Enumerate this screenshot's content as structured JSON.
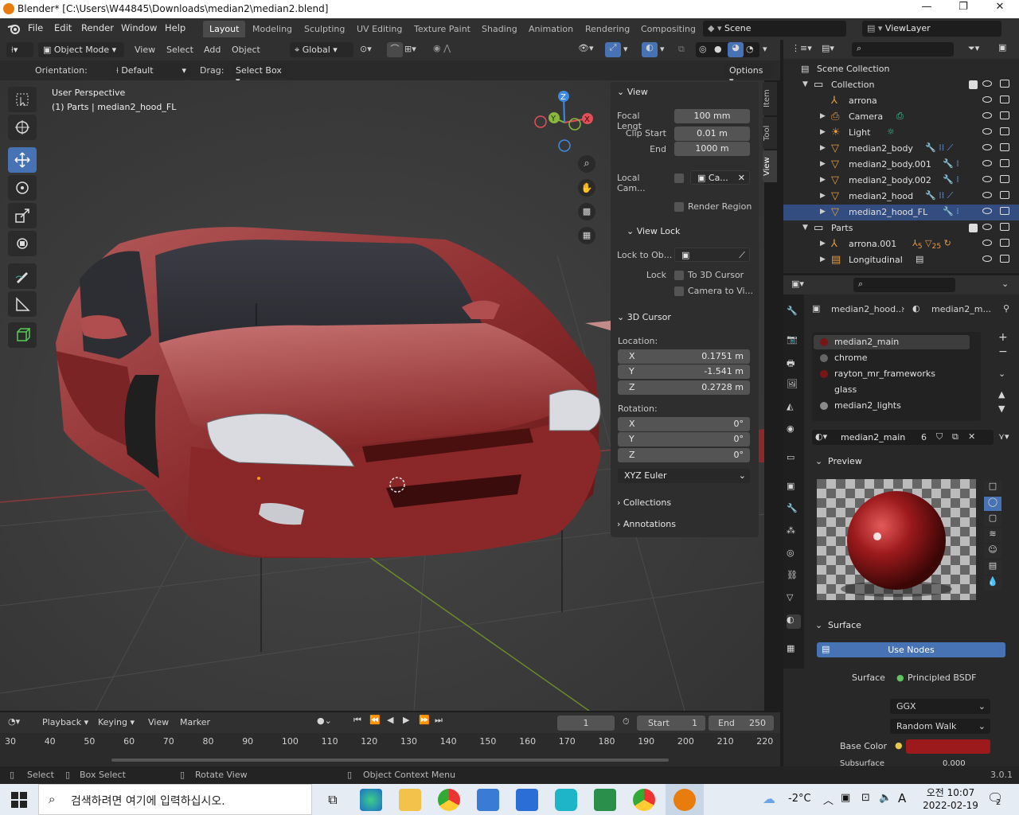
{
  "window": {
    "title": "Blender* [C:\\Users\\W44845\\Downloads\\median2\\median2.blend]",
    "min": "—",
    "max": "❐",
    "close": "✕"
  },
  "menu": [
    "File",
    "Edit",
    "Render",
    "Window",
    "Help"
  ],
  "workspaces": [
    "Layout",
    "Modeling",
    "Sculpting",
    "UV Editing",
    "Texture Paint",
    "Shading",
    "Animation",
    "Rendering",
    "Compositing"
  ],
  "scene": "Scene",
  "view_layer": "ViewLayer",
  "header": {
    "mode": "Object Mode",
    "menus": [
      "View",
      "Select",
      "Add",
      "Object"
    ],
    "transform": "Global"
  },
  "header2": {
    "orientation_label": "Orientation:",
    "orientation": "Default",
    "drag_label": "Drag:",
    "drag": "Select Box",
    "options": "Options"
  },
  "viewport": {
    "line1": "User Perspective",
    "line2": "(1) Parts | median2_hood_FL"
  },
  "gizmo": {
    "x": "X",
    "y": "Y",
    "z": "Z"
  },
  "npanel": {
    "tabs": [
      "Item",
      "Tool",
      "View"
    ],
    "view_title": "View",
    "focal_label": "Focal Lengt",
    "focal": "100 mm",
    "clip_start_label": "Clip Start",
    "clip_start": "0.01 m",
    "end_label": "End",
    "clip_end": "1000 m",
    "local_cam_label": "Local Cam...",
    "local_cam_value": "Ca...",
    "render_region": "Render Region",
    "view_lock_title": "View Lock",
    "lock_to_obj_label": "Lock to Ob...",
    "lock_label": "Lock",
    "to_3d_cursor": "To 3D Cursor",
    "camera_to_view": "Camera to Vi...",
    "cursor_title": "3D Cursor",
    "location_label": "Location:",
    "loc": [
      {
        "axis": "X",
        "value": "0.1751 m"
      },
      {
        "axis": "Y",
        "value": "-1.541 m"
      },
      {
        "axis": "Z",
        "value": "0.2728 m"
      }
    ],
    "rotation_label": "Rotation:",
    "rot": [
      {
        "axis": "X",
        "value": "0°"
      },
      {
        "axis": "Y",
        "value": "0°"
      },
      {
        "axis": "Z",
        "value": "0°"
      }
    ],
    "rot_mode": "XYZ Euler",
    "collections": "Collections",
    "annotations": "Annotations"
  },
  "outliner": {
    "root": "Scene Collection",
    "rows": [
      {
        "name": "Collection",
        "indent": 1,
        "icon": "collection-icon",
        "color": "#e6e6e6"
      },
      {
        "name": "arrona",
        "indent": 2,
        "icon": "armature-icon",
        "color": "#e69a43"
      },
      {
        "name": "Camera",
        "indent": 2,
        "icon": "camera-object-icon",
        "color": "#e69a43"
      },
      {
        "name": "Light",
        "indent": 2,
        "icon": "light-icon",
        "color": "#e69a43"
      },
      {
        "name": "median2_body",
        "indent": 2,
        "icon": "mesh-icon",
        "color": "#e69a43"
      },
      {
        "name": "median2_body.001",
        "indent": 2,
        "icon": "mesh-icon",
        "color": "#e69a43"
      },
      {
        "name": "median2_body.002",
        "indent": 2,
        "icon": "mesh-icon",
        "color": "#e69a43"
      },
      {
        "name": "median2_hood",
        "indent": 2,
        "icon": "mesh-icon",
        "color": "#e69a43"
      },
      {
        "name": "median2_hood_FL",
        "indent": 2,
        "icon": "mesh-icon",
        "color": "#e69a43"
      },
      {
        "name": "Parts",
        "indent": 1,
        "icon": "collection-icon",
        "color": "#e6e6e6"
      },
      {
        "name": "arrona.001",
        "indent": 2,
        "icon": "armature-icon",
        "color": "#e69a43"
      },
      {
        "name": "Longitudinal",
        "indent": 2,
        "icon": "empty-icon",
        "color": "#e69a43"
      }
    ],
    "badge1": "5",
    "badge2": "25"
  },
  "props": {
    "breadcrumb1": "median2_hood...",
    "breadcrumb2": "median2_m...",
    "materials": [
      "median2_main",
      "chrome",
      "rayton_mr_frameworks",
      "glass",
      "median2_lights"
    ],
    "material_name": "median2_main",
    "users": "6",
    "preview": "Preview",
    "surface_section": "Surface",
    "use_nodes": "Use Nodes",
    "surface_label": "Surface",
    "surface_value": "Principled BSDF",
    "distribution": "GGX",
    "subsurface_method": "Random Walk",
    "base_color_label": "Base Color",
    "base_color": "#9c1a1c",
    "subsurface_label": "Subsurface",
    "subsurface_value": "0.000"
  },
  "timeline": {
    "menus": [
      "Playback",
      "Keying",
      "View",
      "Marker"
    ],
    "current": "1",
    "start_label": "Start",
    "start": "1",
    "end_label": "End",
    "end": "250",
    "ticks": [
      "30",
      "40",
      "50",
      "60",
      "70",
      "80",
      "90",
      "100",
      "110",
      "120",
      "130",
      "140",
      "150",
      "160",
      "170",
      "180",
      "190",
      "200",
      "210",
      "220"
    ]
  },
  "status": {
    "select": "Select",
    "box": "Box Select",
    "rotate": "Rotate View",
    "context": "Object Context Menu",
    "version": "3.0.1"
  },
  "taskbar": {
    "search": "검색하려면 여기에 입력하십시오.",
    "temp": "-2°C",
    "ime": "A",
    "time": "오전 10:07",
    "date": "2022-02-19",
    "notif": "2"
  }
}
